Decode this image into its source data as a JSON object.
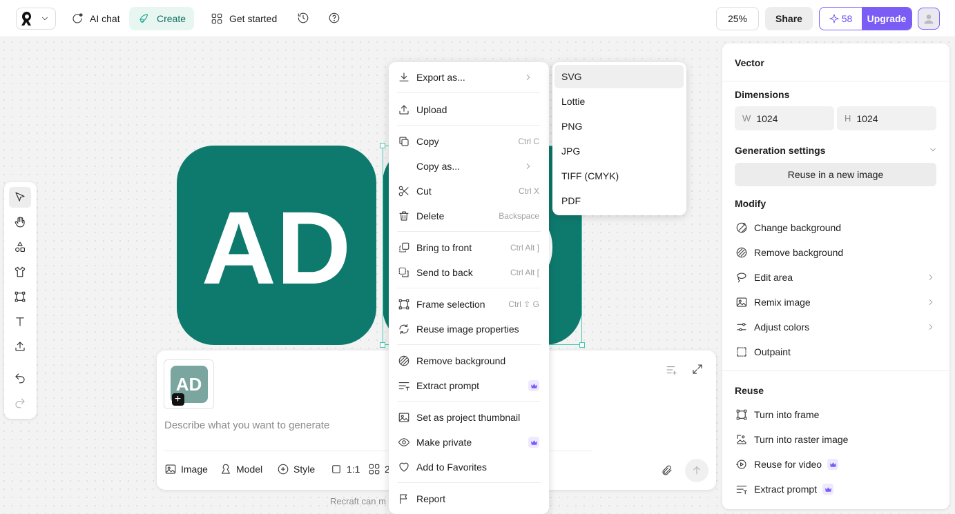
{
  "topbar": {
    "nav": [
      {
        "label": "AI chat",
        "icon": "ai-chat-icon"
      },
      {
        "label": "Create",
        "icon": "create-icon",
        "active": true
      },
      {
        "label": "Get started",
        "icon": "grid-icon"
      }
    ],
    "zoom": "25%",
    "share": "Share",
    "credits": "58",
    "upgrade": "Upgrade"
  },
  "canvas": {
    "logo_text": "AD",
    "tile_color": "#0e7a6d"
  },
  "prompt": {
    "placeholder": "Describe what you want to generate",
    "thumb_text": "AD",
    "buttons": {
      "image": "Image",
      "model": "Model",
      "style": "Style",
      "ratio": "1:1",
      "count": "2"
    },
    "footnote": "Recraft can m"
  },
  "context_menu": {
    "items": [
      {
        "label": "Export as...",
        "icon": "download-icon",
        "submenu": true
      },
      {
        "label": "Upload",
        "icon": "upload-icon"
      },
      {
        "label": "Copy",
        "icon": "copy-icon",
        "shortcut": "Ctrl C"
      },
      {
        "label": "Copy as...",
        "icon": "",
        "submenu": true
      },
      {
        "label": "Cut",
        "icon": "scissors-icon",
        "shortcut": "Ctrl X"
      },
      {
        "label": "Delete",
        "icon": "trash-icon",
        "shortcut": "Backspace"
      },
      {
        "label": "Bring to front",
        "icon": "bring-front-icon",
        "shortcut": "Ctrl Alt ]"
      },
      {
        "label": "Send to back",
        "icon": "send-back-icon",
        "shortcut": "Ctrl Alt ["
      },
      {
        "label": "Frame selection",
        "icon": "frame-icon",
        "shortcut": "Ctrl ⇧ G"
      },
      {
        "label": "Reuse image properties",
        "icon": "refresh-icon"
      },
      {
        "label": "Remove background",
        "icon": "remove-bg-icon"
      },
      {
        "label": "Extract prompt",
        "icon": "extract-prompt-icon",
        "premium": true
      },
      {
        "label": "Set as project thumbnail",
        "icon": "image-icon"
      },
      {
        "label": "Make private",
        "icon": "eye-icon",
        "premium": true
      },
      {
        "label": "Add to Favorites",
        "icon": "heart-icon"
      },
      {
        "label": "Report",
        "icon": "flag-icon"
      }
    ]
  },
  "export_submenu": {
    "items": [
      "SVG",
      "Lottie",
      "PNG",
      "JPG",
      "TIFF (CMYK)",
      "PDF"
    ],
    "highlighted": "SVG"
  },
  "right_panel": {
    "type": "Vector",
    "dimensions_title": "Dimensions",
    "width_label": "W",
    "width": "1024",
    "height_label": "H",
    "height": "1024",
    "generation_title": "Generation settings",
    "reuse_button": "Reuse in a new image",
    "modify_title": "Modify",
    "modify_items": [
      {
        "label": "Change background",
        "icon": "change-bg-icon"
      },
      {
        "label": "Remove background",
        "icon": "remove-bg-icon"
      },
      {
        "label": "Edit area",
        "icon": "lasso-icon",
        "arrow": true
      },
      {
        "label": "Remix image",
        "icon": "image-icon",
        "arrow": true
      },
      {
        "label": "Adjust colors",
        "icon": "sliders-icon",
        "arrow": true
      },
      {
        "label": "Outpaint",
        "icon": "outpaint-icon"
      }
    ],
    "reuse_title": "Reuse",
    "reuse_items": [
      {
        "label": "Turn into frame",
        "icon": "frame-icon"
      },
      {
        "label": "Turn into raster image",
        "icon": "raster-icon"
      },
      {
        "label": "Reuse for video",
        "icon": "video-icon",
        "premium": true
      },
      {
        "label": "Extract prompt",
        "icon": "extract-prompt-icon",
        "premium": true
      }
    ]
  },
  "colors": {
    "accent": "#7b5cf5",
    "brand": "#0e7a6d",
    "selection": "#3fc9ad"
  }
}
